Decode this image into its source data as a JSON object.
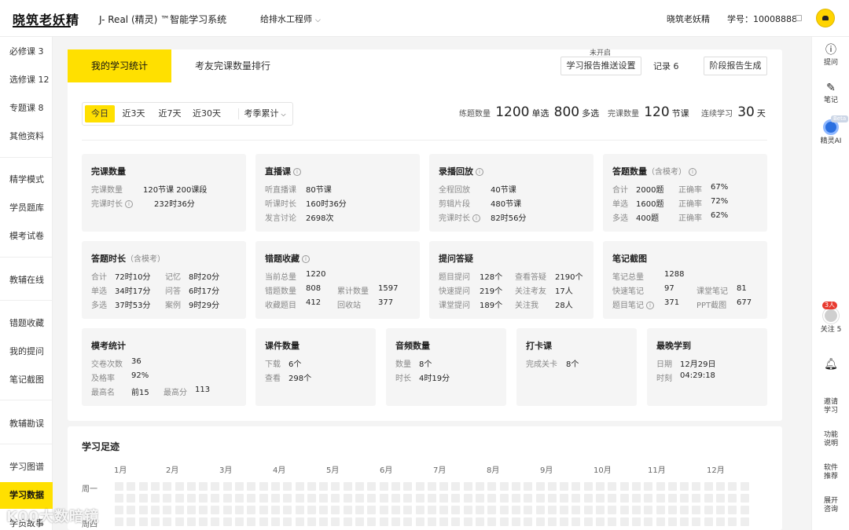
{
  "header": {
    "logo": "晓筑老妖精",
    "app_title": "J- Real (精灵) ™智能学习系统",
    "course": "给排水工程师",
    "username": "晓筑老妖精",
    "uid": "学号：10008888"
  },
  "sidebar": {
    "items": [
      "必修课 3",
      "选修课 12",
      "专题课 8",
      "其他资料",
      "精学模式",
      "学员题库",
      "模考试卷",
      "教辅在线",
      "错题收藏",
      "我的提问",
      "笔记截图",
      "教辅勘误",
      "学习图谱",
      "学习数据",
      "学员故事"
    ],
    "active": "学习数据"
  },
  "rightbar": {
    "ask": "提问",
    "notes": "笔记",
    "ai": "精灵AI",
    "ai_badge": "Beta",
    "follow_badge": "3人",
    "follow": "关注 5",
    "invite": "邀请\n学习",
    "func": "功能\n说明",
    "software": "软件\n推荐",
    "expand": "展开\n咨询"
  },
  "tabs": {
    "active": "我的学习统计",
    "other": "考友完课数量排行",
    "push_state": "未开启",
    "push_button": "学习报告推送设置",
    "records": "记录 6",
    "stage_button": "阶段报告生成"
  },
  "filters": {
    "items": [
      "今日",
      "近3天",
      "近7天",
      "近30天",
      "考季累计"
    ],
    "active": "今日"
  },
  "summary": {
    "practice_label": "练题数量",
    "single_val": "1200",
    "single_unit": "单选",
    "multi_val": "800",
    "multi_unit": "多选",
    "done_label": "完课数量",
    "done_val": "120",
    "done_unit": "节课",
    "streak_label": "连续学习",
    "streak_val": "30",
    "streak_unit": "天"
  },
  "cards": {
    "c1": {
      "title": "完课数量",
      "r1k": "完课数量",
      "r1v": "120节课   200课段",
      "r2k": "完课时长",
      "r2v": "232时36分"
    },
    "c2": {
      "title": "直播课",
      "r1k": "听直播课",
      "r1v": "80节课",
      "r2k": "听课时长",
      "r2v": "160时36分",
      "r3k": "发言讨论",
      "r3v": "2698次"
    },
    "c3": {
      "title": "录播回放",
      "r1k": "全程回放",
      "r1v": "40节课",
      "r2k": "剪辑片段",
      "r2v": "480节课",
      "r3k": "完课时长",
      "r3v": "82时56分"
    },
    "c4": {
      "title": "答题数量",
      "sub": "（含模考）",
      "r1k": "合计",
      "r1v": "2000题",
      "r1k2": "正确率",
      "r1v2": "67%",
      "r2k": "单选",
      "r2v": "1600题",
      "r2k2": "正确率",
      "r2v2": "72%",
      "r3k": "多选",
      "r3v": "400题",
      "r3k2": "正确率",
      "r3v2": "62%"
    },
    "c5": {
      "title": "答题时长",
      "sub": "（含模考）",
      "r1k": "合计",
      "r1v": "72时10分",
      "r1k2": "记忆",
      "r1v2": "8时20分",
      "r2k": "单选",
      "r2v": "34时17分",
      "r2k2": "问答",
      "r2v2": "6时17分",
      "r3k": "多选",
      "r3v": "37时53分",
      "r3k2": "案例",
      "r3v2": "9时29分"
    },
    "c6": {
      "title": "错题收藏",
      "r1k": "当前总量",
      "r1v": "1220",
      "r2k": "错题数量",
      "r2v": "808",
      "r2k2": "累计数量",
      "r2v2": "1597",
      "r3k": "收藏题目",
      "r3v": "412",
      "r3k2": "回收站",
      "r3v2": "377"
    },
    "c7": {
      "title": "提问答疑",
      "r1k": "题目提问",
      "r1v": "128个",
      "r1k2": "查看答疑",
      "r1v2": "2190个",
      "r2k": "快速提问",
      "r2v": "219个",
      "r2k2": "关注考友",
      "r2v2": "17人",
      "r3k": "课堂提问",
      "r3v": "189个",
      "r3k2": "关注我",
      "r3v2": "28人"
    },
    "c8": {
      "title": "笔记截图",
      "r1k": "笔记总量",
      "r1v": "1288",
      "r2k": "快速笔记",
      "r2v": "97",
      "r2k2": "课堂笔记",
      "r2v2": "81",
      "r3k": "题目笔记",
      "r3v": "371",
      "r3k2": "PPT截图",
      "r3v2": "677"
    },
    "c9": {
      "title": "模考统计",
      "r1k": "交卷次数",
      "r1v": "36",
      "r2k": "及格率",
      "r2v": "92%",
      "r3k": "最高名",
      "r3v": "前15",
      "r3k2": "最高分",
      "r3v2": "113"
    },
    "c10": {
      "title": "课件数量",
      "r1k": "下载",
      "r1v": "6个",
      "r2k": "查看",
      "r2v": "298个"
    },
    "c11": {
      "title": "音频数量",
      "r1k": "数量",
      "r1v": "8个",
      "r2k": "时长",
      "r2v": "4时19分"
    },
    "c12": {
      "title": "打卡课",
      "r1k": "完成关卡",
      "r1v": "8个"
    },
    "c13": {
      "title": "最晚学到",
      "r1k": "日期",
      "r1v": "12月29日",
      "r2k": "时刻",
      "r2v": "04:29:18"
    }
  },
  "footprint": {
    "title": "学习足迹",
    "months": [
      "1月",
      "2月",
      "3月",
      "4月",
      "5月",
      "6月",
      "7月",
      "8月",
      "9月",
      "10月",
      "11月",
      "12月"
    ],
    "days": [
      "周一",
      "",
      "",
      "周四"
    ]
  },
  "watermark": "K00大数暗镜",
  "colors": {
    "accent": "#ffe000",
    "card_bg": "#f5f5f5",
    "page_bg": "#f4f4f4"
  }
}
